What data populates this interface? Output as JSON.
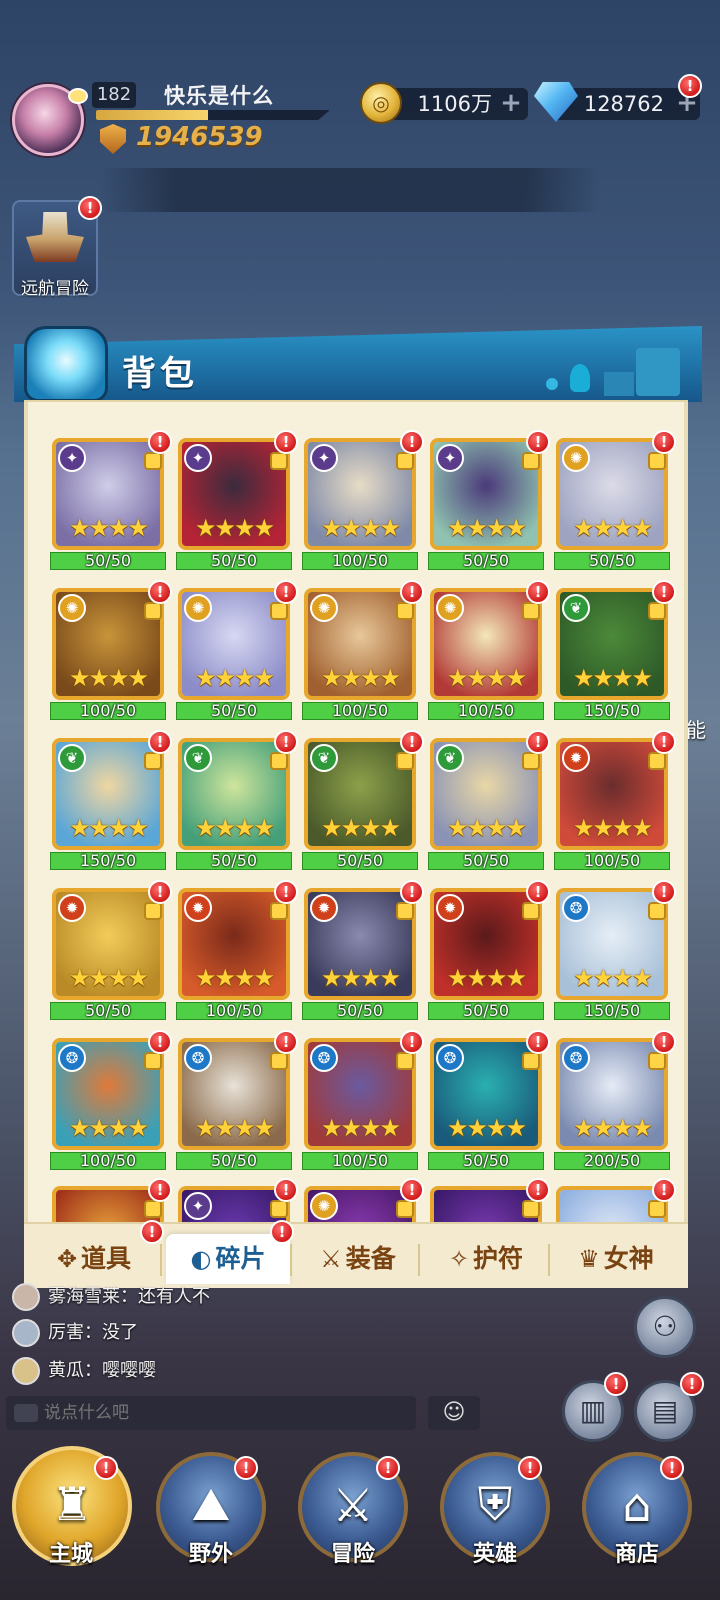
{
  "player": {
    "level": "182",
    "name": "快乐是什么",
    "xp_fraction": 0.48,
    "power": "1946539"
  },
  "currencies": {
    "gold": "1106万",
    "gems": "128762"
  },
  "voyage": {
    "label": "远航冒险"
  },
  "backpack": {
    "title": "背包"
  },
  "hero_rows": [
    [
      {
        "faction": "dark",
        "count": "50/50",
        "art": [
          "#cfcde8",
          "#7b6fa6"
        ]
      },
      {
        "faction": "dark",
        "count": "50/50",
        "art": [
          "#3b2b3d",
          "#b52436"
        ]
      },
      {
        "faction": "dark",
        "count": "100/50",
        "art": [
          "#e7dcc6",
          "#7f8aa8"
        ]
      },
      {
        "faction": "dark",
        "count": "50/50",
        "art": [
          "#4b3a7a",
          "#8fc2b0"
        ]
      },
      {
        "faction": "light",
        "count": "50/50",
        "art": [
          "#dcdbe8",
          "#9da3c0"
        ]
      }
    ],
    [
      {
        "faction": "light",
        "count": "100/50",
        "art": [
          "#c8943a",
          "#7a4a1a"
        ]
      },
      {
        "faction": "light",
        "count": "50/50",
        "art": [
          "#d7d8f2",
          "#8c8cc8"
        ]
      },
      {
        "faction": "light",
        "count": "100/50",
        "art": [
          "#e8c89a",
          "#a1602f"
        ]
      },
      {
        "faction": "light",
        "count": "100/50",
        "art": [
          "#f3e7b8",
          "#b23a36"
        ]
      },
      {
        "faction": "nature",
        "count": "150/50",
        "art": [
          "#4c8a3a",
          "#2e5a28"
        ]
      }
    ],
    [
      {
        "faction": "nature",
        "count": "150/50",
        "art": [
          "#f0d6a2",
          "#5aa6d6"
        ]
      },
      {
        "faction": "nature",
        "count": "50/50",
        "art": [
          "#cfe59c",
          "#45a07a"
        ]
      },
      {
        "faction": "nature",
        "count": "50/50",
        "art": [
          "#8ca04a",
          "#4a5a2a"
        ]
      },
      {
        "faction": "nature",
        "count": "50/50",
        "art": [
          "#e9d7a6",
          "#8a93b5"
        ]
      },
      {
        "faction": "fire",
        "count": "100/50",
        "art": [
          "#6a2d2d",
          "#d04a3a"
        ]
      }
    ],
    [
      {
        "faction": "fire",
        "count": "50/50",
        "art": [
          "#f2cc5a",
          "#b98a26"
        ]
      },
      {
        "faction": "fire",
        "count": "100/50",
        "art": [
          "#7a2a1a",
          "#d65a2a"
        ]
      },
      {
        "faction": "fire",
        "count": "50/50",
        "art": [
          "#8a8ab0",
          "#3a3a5a"
        ]
      },
      {
        "faction": "fire",
        "count": "50/50",
        "art": [
          "#5a1a1a",
          "#c0302a"
        ]
      },
      {
        "faction": "water",
        "count": "150/50",
        "art": [
          "#e6eef6",
          "#a8c0d8"
        ]
      }
    ],
    [
      {
        "faction": "water",
        "count": "100/50",
        "art": [
          "#e07a3a",
          "#3aa0b8"
        ]
      },
      {
        "faction": "water",
        "count": "50/50",
        "art": [
          "#e8e2d8",
          "#8a6a4a"
        ]
      },
      {
        "faction": "water",
        "count": "100/50",
        "art": [
          "#6a5aa0",
          "#a03a3a"
        ]
      },
      {
        "faction": "water",
        "count": "50/50",
        "art": [
          "#2ab0b0",
          "#1a5a7a"
        ]
      },
      {
        "faction": "water",
        "count": "200/50",
        "art": [
          "#e6ecf6",
          "#7a8ab0"
        ]
      }
    ],
    [
      {
        "faction": "none",
        "count": "",
        "art": [
          "#e7a23a",
          "#a0301a"
        ]
      },
      {
        "faction": "dark",
        "count": "",
        "art": [
          "#6a3ab0",
          "#3a1a6a"
        ]
      },
      {
        "faction": "light",
        "count": "",
        "art": [
          "#8a3ab0",
          "#4a1a6a"
        ]
      },
      {
        "faction": "none",
        "count": "",
        "art": [
          "#7a3ab0",
          "#3a1a6a"
        ]
      },
      {
        "faction": "none",
        "count": "",
        "art": [
          "#dfe7f6",
          "#8fb0e0"
        ]
      }
    ]
  ],
  "faction_colors": {
    "dark": "#5a3b8c",
    "light": "#e0a020",
    "nature": "#2e9a3a",
    "fire": "#d0401a",
    "water": "#1e78c8",
    "none": "transparent"
  },
  "faction_symbols": {
    "dark": "✦",
    "light": "✺",
    "nature": "❦",
    "fire": "✹",
    "water": "❂",
    "none": ""
  },
  "tabs": [
    {
      "label": "道具",
      "icon": "✥",
      "active": false
    },
    {
      "label": "碎片",
      "icon": "◐",
      "active": true
    },
    {
      "label": "装备",
      "icon": "⚔",
      "active": false
    },
    {
      "label": "护符",
      "icon": "✧",
      "active": false
    },
    {
      "label": "女神",
      "icon": "♛",
      "active": false
    }
  ],
  "chat": [
    {
      "name": "雾海雪莱",
      "message": "还有人不",
      "avatar_color": "#c9b6a8"
    },
    {
      "name": "厉害",
      "message": "没了",
      "avatar_color": "#a8b6c9"
    },
    {
      "name": "黄瓜",
      "message": "嘤嘤嘤",
      "avatar_color": "#d8c28a"
    }
  ],
  "chat_input": {
    "placeholder": "说点什么吧"
  },
  "edge_text": "能",
  "bottom_nav": [
    {
      "label": "主城",
      "emblem": "♜",
      "active": true
    },
    {
      "label": "野外",
      "emblem": "⛰",
      "active": false
    },
    {
      "label": "冒险",
      "emblem": "⚔",
      "active": false
    },
    {
      "label": "英雄",
      "emblem": "⛨",
      "active": false
    },
    {
      "label": "商店",
      "emblem": "⌂",
      "active": false
    }
  ]
}
